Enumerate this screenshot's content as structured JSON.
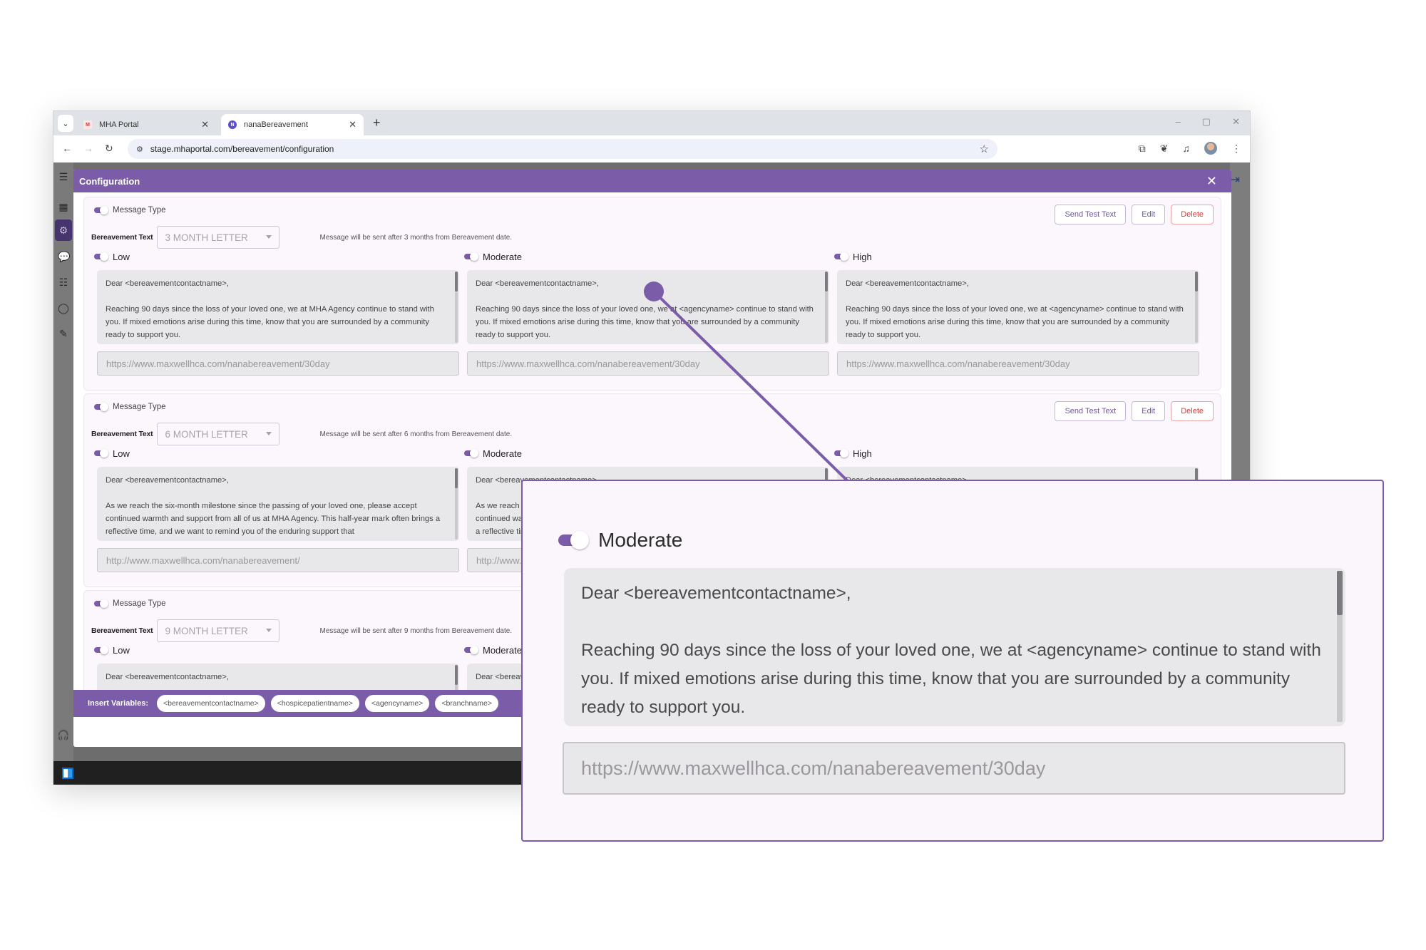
{
  "browser": {
    "tabs": [
      {
        "title": "MHA Portal",
        "favicon": "M",
        "active": false
      },
      {
        "title": "nanaBereavement",
        "favicon": "N",
        "active": true
      }
    ],
    "url": "stage.mhaportal.com/bereavement/configuration",
    "icons": {
      "tab_search": "⌄",
      "tab_close": "✕",
      "new_tab": "+",
      "minimize": "–",
      "restore": "▢",
      "close": "✕",
      "back": "←",
      "forward": "→",
      "reload": "↻",
      "site_info": "⚙",
      "bookmark": "☆",
      "extensions": "⧉",
      "leaf": "❦",
      "media": "♫",
      "menu": "⋮"
    }
  },
  "app": {
    "sidebar_icons": {
      "menu": "☰",
      "dashboard": "▦",
      "settings": "⚙",
      "chat": "💬",
      "users": "☷",
      "account": "◯",
      "feedback": "✎",
      "support": "🎧"
    },
    "logout_icon": "⇥"
  },
  "modal": {
    "title": "Configuration",
    "close_icon": "✕",
    "cards": [
      {
        "message_type_label": "Message Type",
        "bereavement_text_label": "Bereavement Text",
        "selected_letter": "3 MONTH LETTER",
        "note": "Message will be sent after 3 months from Bereavement date.",
        "buttons": {
          "send_test": "Send Test Text",
          "edit": "Edit",
          "delete": "Delete"
        },
        "severities": [
          {
            "label": "Low",
            "greeting": "Dear <bereavementcontactname>,",
            "body": "Reaching 90 days since the loss of your loved one, we at MHA Agency continue to stand with you. If mixed emotions arise during this time, know that you are surrounded by a community ready to support you.",
            "url": "https://www.maxwellhca.com/nanabereavement/30day"
          },
          {
            "label": "Moderate",
            "greeting": "Dear <bereavementcontactname>,",
            "body": "Reaching 90 days since the loss of your loved one, we at <agencyname> continue to stand with you. If mixed emotions arise during this time, know that you are surrounded by a community ready to support you.",
            "url": "https://www.maxwellhca.com/nanabereavement/30day"
          },
          {
            "label": "High",
            "greeting": "Dear <bereavementcontactname>,",
            "body": "Reaching 90 days since the loss of your loved one, we at <agencyname> continue to stand with you. If mixed emotions arise during this time, know that you are surrounded by a community ready to support you.",
            "url": "https://www.maxwellhca.com/nanabereavement/30day"
          }
        ]
      },
      {
        "message_type_label": "Message Type",
        "bereavement_text_label": "Bereavement Text",
        "selected_letter": "6 MONTH LETTER",
        "note": "Message will be sent after 6 months from Bereavement date.",
        "buttons": {
          "send_test": "Send Test Text",
          "edit": "Edit",
          "delete": "Delete"
        },
        "severities": [
          {
            "label": "Low",
            "greeting": "Dear <bereavementcontactname>,",
            "body": "As we reach the six-month milestone since the passing of your loved one, please accept continued warmth and support from all of us at MHA Agency. This half-year mark often brings a reflective time, and we want to remind you of the enduring support that",
            "url": "http://www.maxwellhca.com/nanabereavement/"
          },
          {
            "label": "Moderate",
            "greeting": "Dear <bereavementcontactname>,",
            "body": "As we reach the six-month milestone since the passing of your loved one, please accept continued warmth and support from all of us at <agencyname>. This half-year mark often brings a reflective time, and we want to remind you of the enduring support that",
            "url": "http://www.maxwellhca.com/nanabereavement/"
          },
          {
            "label": "High",
            "greeting": "Dear <bereavementcontactname>,",
            "body": "",
            "url": ""
          }
        ]
      },
      {
        "message_type_label": "Message Type",
        "bereavement_text_label": "Bereavement Text",
        "selected_letter": "9 MONTH LETTER",
        "note": "Message will be sent after 9 months from Bereavement date.",
        "severities": [
          {
            "label": "Low",
            "greeting": "Dear <bereavementcontactname>,"
          },
          {
            "label": "Moderate",
            "greeting": "Dear <bereavementcontactname>,"
          }
        ]
      }
    ],
    "insert_variables": {
      "label": "Insert Variables:",
      "chips": [
        "<bereavementcontactname>",
        "<hospicepatientname>",
        "<agencyname>",
        "<branchname>"
      ]
    }
  },
  "callout": {
    "label": "Moderate",
    "greeting": "Dear <bereavementcontactname>,",
    "body": "Reaching 90 days since the loss of your loved one, we at <agencyname> continue to stand with you. If mixed emotions arise during this time, know that you are surrounded by a community ready to support you.",
    "url": "https://www.maxwellhca.com/nanabereavement/30day",
    "accent_color": "#7b5ca8"
  },
  "colors": {
    "brand_purple": "#7b5ca8",
    "delete_red": "#d83a3a",
    "card_bg": "#fcf6fd",
    "message_bg": "#e8e7e9"
  }
}
